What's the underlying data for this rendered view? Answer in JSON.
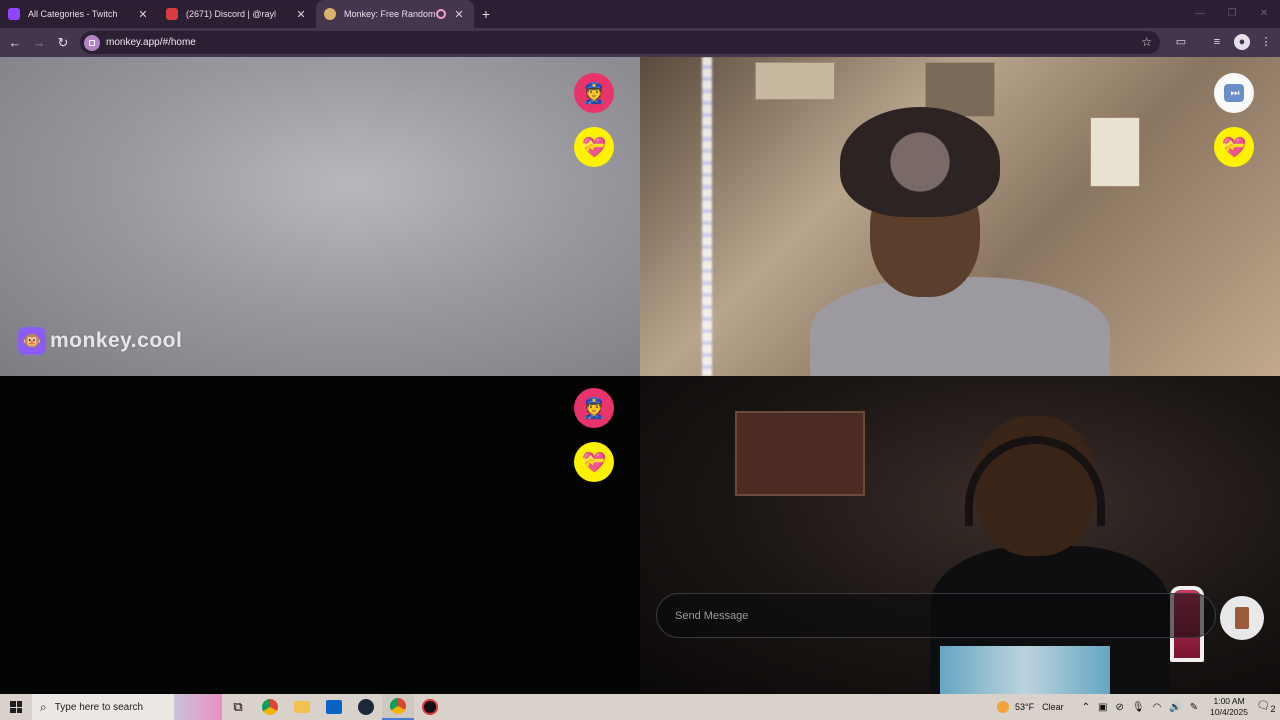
{
  "browser": {
    "tabs": [
      {
        "title": "All Categories - Twitch",
        "favicon_color": "#9146ff",
        "active": false
      },
      {
        "title": "(2671) Discord | @rayl",
        "favicon_color": "#d83c3e",
        "active": false
      },
      {
        "title": "Monkey: Free Random Vide",
        "favicon_color": "#d9b36a",
        "active": true,
        "recording": true
      }
    ],
    "new_tab": "+",
    "url": "monkey.app/#/home"
  },
  "app": {
    "brand_name": "monkey.cool",
    "brand_icon": "🐵",
    "report_icon": "👮",
    "heart_icon": "💝",
    "skip_icon": "⏭",
    "message_placeholder": "Send Message",
    "accent_red": "#e8336b",
    "accent_yellow": "#fff200"
  },
  "taskbar": {
    "search_placeholder": "Type here to search",
    "weather_temp": "53°F",
    "weather_cond": "Clear",
    "time": "1:00 AM",
    "date": "10/4/2025",
    "notif_count": "2"
  }
}
